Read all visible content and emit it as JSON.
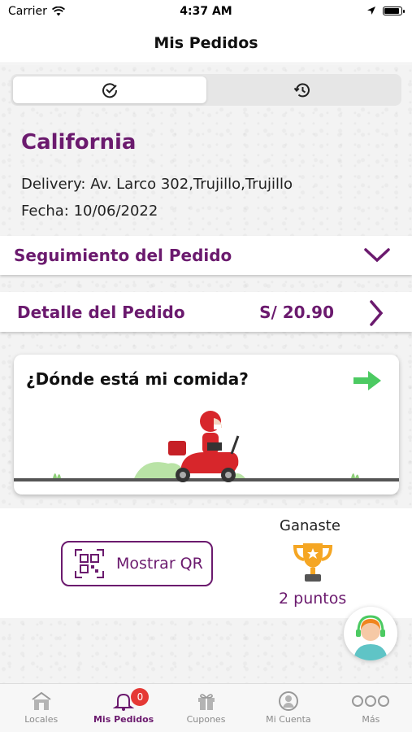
{
  "status_bar": {
    "carrier": "Carrier",
    "time": "4:37 AM"
  },
  "header": {
    "title": "Mis Pedidos"
  },
  "segment": {
    "tabs": [
      {
        "icon": "check-circle-icon",
        "active": true
      },
      {
        "icon": "history-icon",
        "active": false
      }
    ]
  },
  "order": {
    "store_name": "California",
    "delivery": "Delivery: Av. Larco 302,Trujillo,Trujillo",
    "date": "Fecha: 10/06/2022"
  },
  "tracking": {
    "label": "Seguimiento del Pedido"
  },
  "detail": {
    "label": "Detalle del Pedido",
    "amount": "S/ 20.90"
  },
  "food_card": {
    "title": "¿Dónde está mi comida?"
  },
  "rewards": {
    "qr_button": "Mostrar QR",
    "won_label": "Ganaste",
    "points": "2 puntos"
  },
  "tab_bar": {
    "items": [
      {
        "label": "Locales",
        "icon": "store-icon"
      },
      {
        "label": "Mis Pedidos",
        "icon": "bell-icon",
        "badge": "0",
        "active": true
      },
      {
        "label": "Cupones",
        "icon": "gift-icon"
      },
      {
        "label": "Mi Cuenta",
        "icon": "user-icon"
      },
      {
        "label": "Más",
        "icon": "more-icon"
      }
    ]
  },
  "colors": {
    "brand": "#6b1a6e",
    "accent_green": "#4cca62",
    "badge_red": "#e53935"
  }
}
